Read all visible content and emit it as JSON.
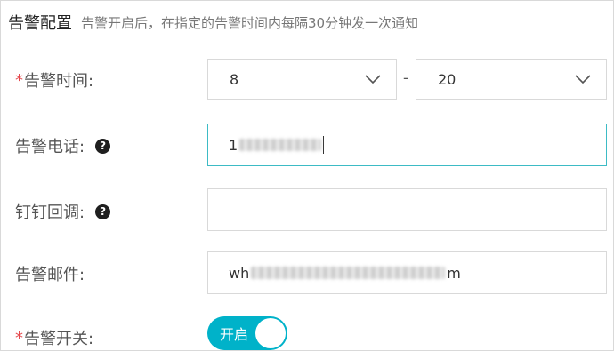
{
  "header": {
    "title": "告警配置",
    "hint": "告警开启后，在指定的告警时间内每隔30分钟发一次通知"
  },
  "alert_time": {
    "required_mark": "*",
    "label": "告警时间:",
    "start": "8",
    "separator": "-",
    "end": "20"
  },
  "alert_phone": {
    "label": "告警电话:",
    "help": "?",
    "value_prefix": "1"
  },
  "dingtalk": {
    "label": "钉钉回调:",
    "help": "?",
    "value": ""
  },
  "alert_email": {
    "label": "告警邮件:",
    "value_prefix": "wh",
    "value_suffix": "m"
  },
  "alert_switch": {
    "required_mark": "*",
    "label": "告警开关:",
    "state_label": "开启",
    "enabled": true
  },
  "colors": {
    "accent": "#00b2c9",
    "focus_border": "#3dbbc5",
    "required": "#e5484d"
  }
}
